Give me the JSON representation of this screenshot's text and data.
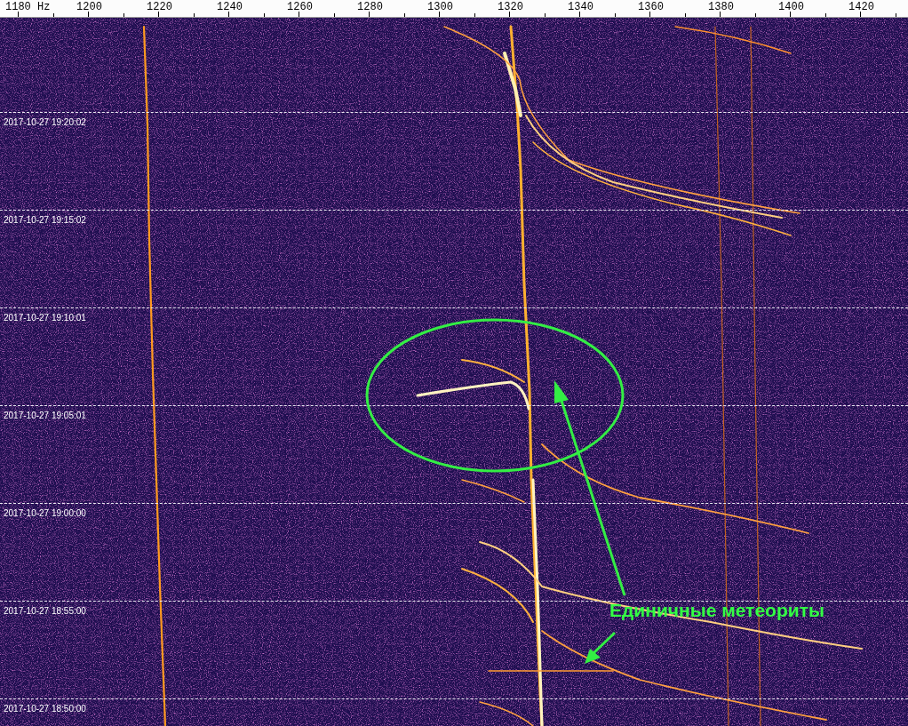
{
  "frequency_axis": {
    "labels": [
      "1180 Hz",
      "1200",
      "1220",
      "1240",
      "1260",
      "1280",
      "1300",
      "1320",
      "1340",
      "1360",
      "1380",
      "1400",
      "1420"
    ]
  },
  "spectrogram": {
    "time_labels": [
      "2017-10-27 19:20:02",
      "2017-10-27 19:15:02",
      "2017-10-27 19:10:01",
      "2017-10-27 19:05:01",
      "2017-10-27 19:00:00",
      "2017-10-27 18:55:00",
      "2017-10-27 18:50:00"
    ]
  },
  "annotation": {
    "text": "Единичные метеориты"
  }
}
